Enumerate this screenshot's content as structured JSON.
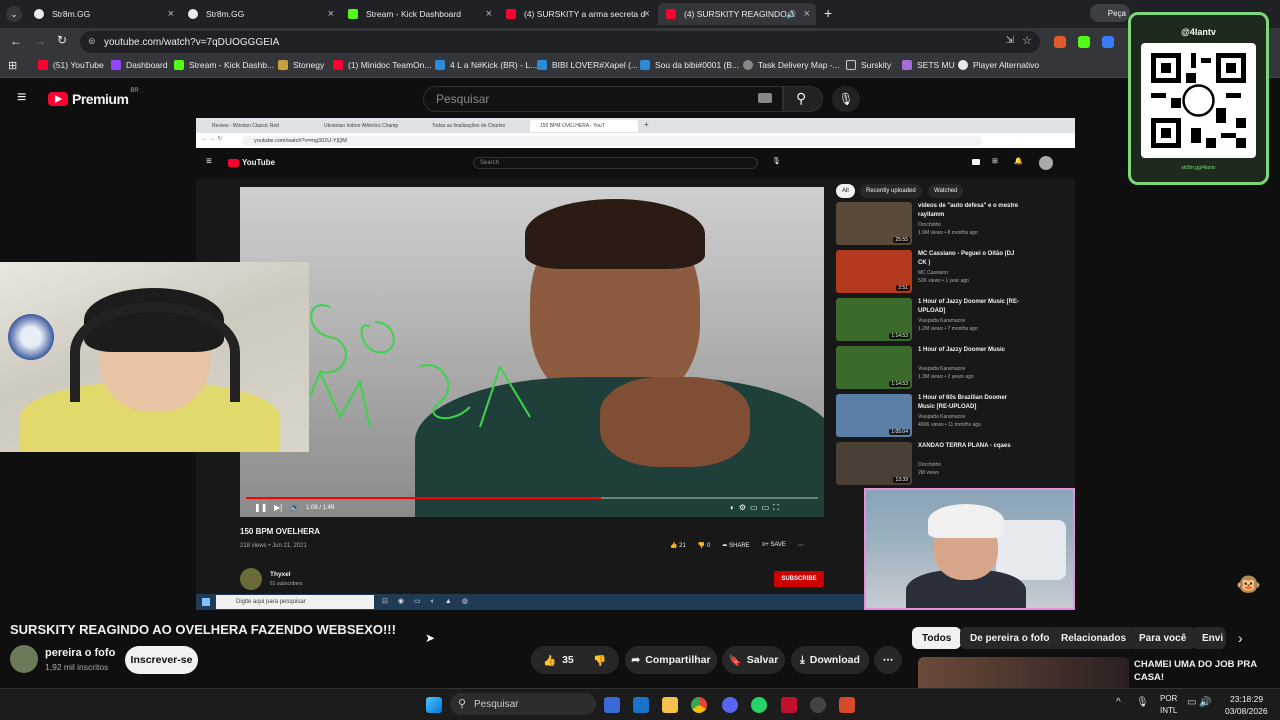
{
  "browser": {
    "tabs": [
      {
        "label": "Str8m.GG",
        "color": "#e8eaed"
      },
      {
        "label": "Str8m.GG",
        "color": "#e8eaed"
      },
      {
        "label": "Stream - Kick Dashboard",
        "color": "#53fc18"
      },
      {
        "label": "(4) SURSKITY a arma secreta d",
        "color": "#ff0033"
      },
      {
        "label": "(4) SURSKITY REAGINDO A",
        "color": "#ff0033"
      }
    ],
    "new_tab": "+",
    "profile_chip": "Peça",
    "url": "youtube.com/watch?v=7qDUOGGGEIA",
    "bookmarks": [
      "(51) YouTube",
      "Dashboard",
      "Stream - Kick Dashb...",
      "Stonegy",
      "(1) Minidoc TeamOn...",
      "4 L a N#Kick (BR) - L...",
      "BIBI LOVER#Xapel (...",
      "Sou da bibi#0001 (B...",
      "Task Delivery Map -...",
      "Surskity",
      "SETS MU",
      "Player Alternativo"
    ]
  },
  "youtube": {
    "logo": "Premium",
    "logo_region": "BR",
    "search_placeholder": "Pesquisar",
    "video_title": "SURSKITY REAGINDO AO OVELHERA FAZENDO WEBSEXO!!!",
    "channel": "pereira o fofo",
    "subscribers": "1,92 mil inscritos",
    "subscribe_label": "Inscrever-se",
    "likes": "35",
    "share_label": "Compartilhar",
    "save_label": "Salvar",
    "download_label": "Download",
    "chips": [
      "Todos",
      "De pereira o fofo",
      "Relacionados",
      "Para você",
      "Envi"
    ],
    "next_video_title": "CHAMEI UMA DO JOB PRA CASA!"
  },
  "inner": {
    "tabs": [
      "Review - Winston Classic Red",
      "Ukrainian Indoor Athletics Champ",
      "Todas as finalizações de Charles",
      "150 BPM OVELHERA - YouT"
    ],
    "url": "youtube.com/watch?v=mg302U-YjQM",
    "logo": "YouTube",
    "search_placeholder": "Search",
    "time": "1:08 / 1:49",
    "progress": 0.62,
    "video_title": "150 BPM OVELHERA",
    "views_date": "218 views • Jun 21, 2021",
    "likes": "21",
    "dislikes": "0",
    "share": "SHARE",
    "save": "SAVE",
    "channel": "Thyxel",
    "subs": "61 subscribers",
    "subscribe": "SUBSCRIBE",
    "chips": [
      "All",
      "Recently uploaded",
      "Watched"
    ],
    "recs": [
      {
        "title": "videos de \"auto defesa\" e o mestre rayllamm",
        "channel": "Orochinho",
        "meta": "1.9M views • 8 months ago",
        "dur": "25:55",
        "color": "#5a4a3a"
      },
      {
        "title": "MC Cassiano - Peguei o Oitão (DJ CK )",
        "channel": "MC Cassiano",
        "meta": "52K views • 1 year ago",
        "dur": "2:51",
        "color": "#b33a1f"
      },
      {
        "title": "1 Hour of Jazzy Doomer Music [RE-UPLOAD]",
        "channel": "Viaspatta Karamazov",
        "meta": "1.2M views • 7 months ago",
        "dur": "1:14:53",
        "color": "#3a6b2a"
      },
      {
        "title": "1 Hour of Jazzy Doomer Music",
        "channel": "Viaspatta Karamazov",
        "meta": "1.3M views • 2 years ago",
        "dur": "1:14:53",
        "color": "#3a6b2a"
      },
      {
        "title": "1 Hour of 60s Brazilian Doomer Music [RE-UPLOAD]",
        "channel": "Viaspatta Karamazov",
        "meta": "469K views • 11 months ago",
        "dur": "1:05:04",
        "color": "#5c7fa8"
      },
      {
        "title": "XANDAO TERRA PLANA - cqaes",
        "channel": "Orochinho",
        "meta": "2M views",
        "dur": "13:39",
        "color": "#4a4035"
      }
    ],
    "taskbar_search": "Digite aqui para pesquisar"
  },
  "overlay": {
    "qr_handle": "@4lantv",
    "qr_url": "str8m.gg/4lantv"
  },
  "taskbar": {
    "search_placeholder": "Pesquisar",
    "lang1": "POR",
    "lang2": "INTL",
    "time": "23:18:29",
    "date": "03/08/2026"
  }
}
